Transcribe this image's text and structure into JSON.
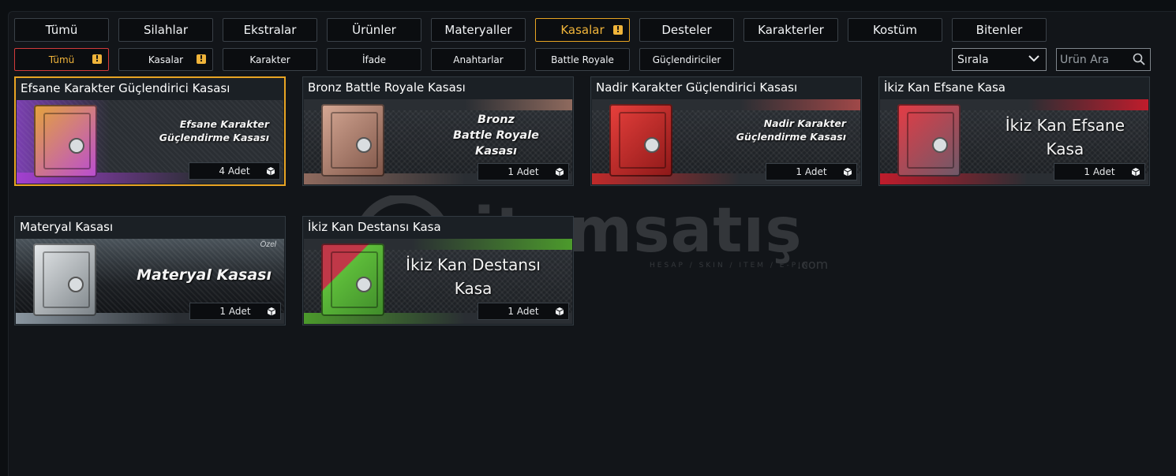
{
  "main_tabs": [
    {
      "label": "Tümü"
    },
    {
      "label": "Silahlar"
    },
    {
      "label": "Ekstralar"
    },
    {
      "label": "Ürünler"
    },
    {
      "label": "Materyaller"
    },
    {
      "label": "Kasalar",
      "active": true,
      "warning": true
    },
    {
      "label": "Desteler"
    },
    {
      "label": "Karakterler"
    },
    {
      "label": "Kostüm"
    },
    {
      "label": "Bitenler"
    }
  ],
  "sub_tabs": [
    {
      "label": "Tümü",
      "active": true,
      "warning": true
    },
    {
      "label": "Kasalar",
      "warning": true
    },
    {
      "label": "Karakter"
    },
    {
      "label": "İfade"
    },
    {
      "label": "Anahtarlar"
    },
    {
      "label": "Battle Royale"
    },
    {
      "label": "Güçlendiriciler"
    }
  ],
  "sort": {
    "label": "Sırala"
  },
  "search": {
    "placeholder": "Ürün Ara"
  },
  "items": [
    {
      "title": "Efsane Karakter Güçlendirici Kasası",
      "banner": [
        "Efsane Karakter",
        "Güçlendirme  Kasası"
      ],
      "qty": "4 Adet",
      "selected": true,
      "safe_color": "#c489d6",
      "accent": "#e08b2c"
    },
    {
      "title": "Bronz Battle Royale Kasası",
      "banner": [
        "Bronz",
        "Battle Royale",
        "Kasası"
      ],
      "qty": "1 Adet",
      "safe_color": "#b98a76",
      "accent": "#b07b6c"
    },
    {
      "title": "Nadir Karakter Güçlendirici Kasası",
      "banner": [
        "Nadir Karakter",
        "Güçlendirme  Kasası"
      ],
      "qty": "1 Adet",
      "safe_color": "#d0302e",
      "accent": "#a04848"
    },
    {
      "title": "İkiz Kan Efsane Kasa",
      "banner": [
        "İkiz Kan Efsane",
        "Kasa"
      ],
      "qty": "1 Adet",
      "safe_color": "#c42430",
      "accent": "#b0202c"
    },
    {
      "title": "Materyal Kasası",
      "banner": [
        "Materyal Kasası"
      ],
      "qty": "1 Adet",
      "badge": "Özel",
      "safe_color": "#b9bec2",
      "accent": "#7d878e"
    },
    {
      "title": "İkiz Kan Destansı Kasa",
      "banner": [
        "İkiz Kan Destansı",
        "Kasa"
      ],
      "qty": "1 Adet",
      "safe_color": "#58b03a",
      "accent": "#4c9a2c"
    }
  ],
  "watermark": {
    "brand": "itemsatış",
    "tagline": "HESAP / SKIN / ITEM / E-PIN",
    "suffix": ".com"
  },
  "colors": {
    "accent": "#e8a423",
    "warning": "#f0b43a",
    "active_sub": "#d23b3b"
  }
}
